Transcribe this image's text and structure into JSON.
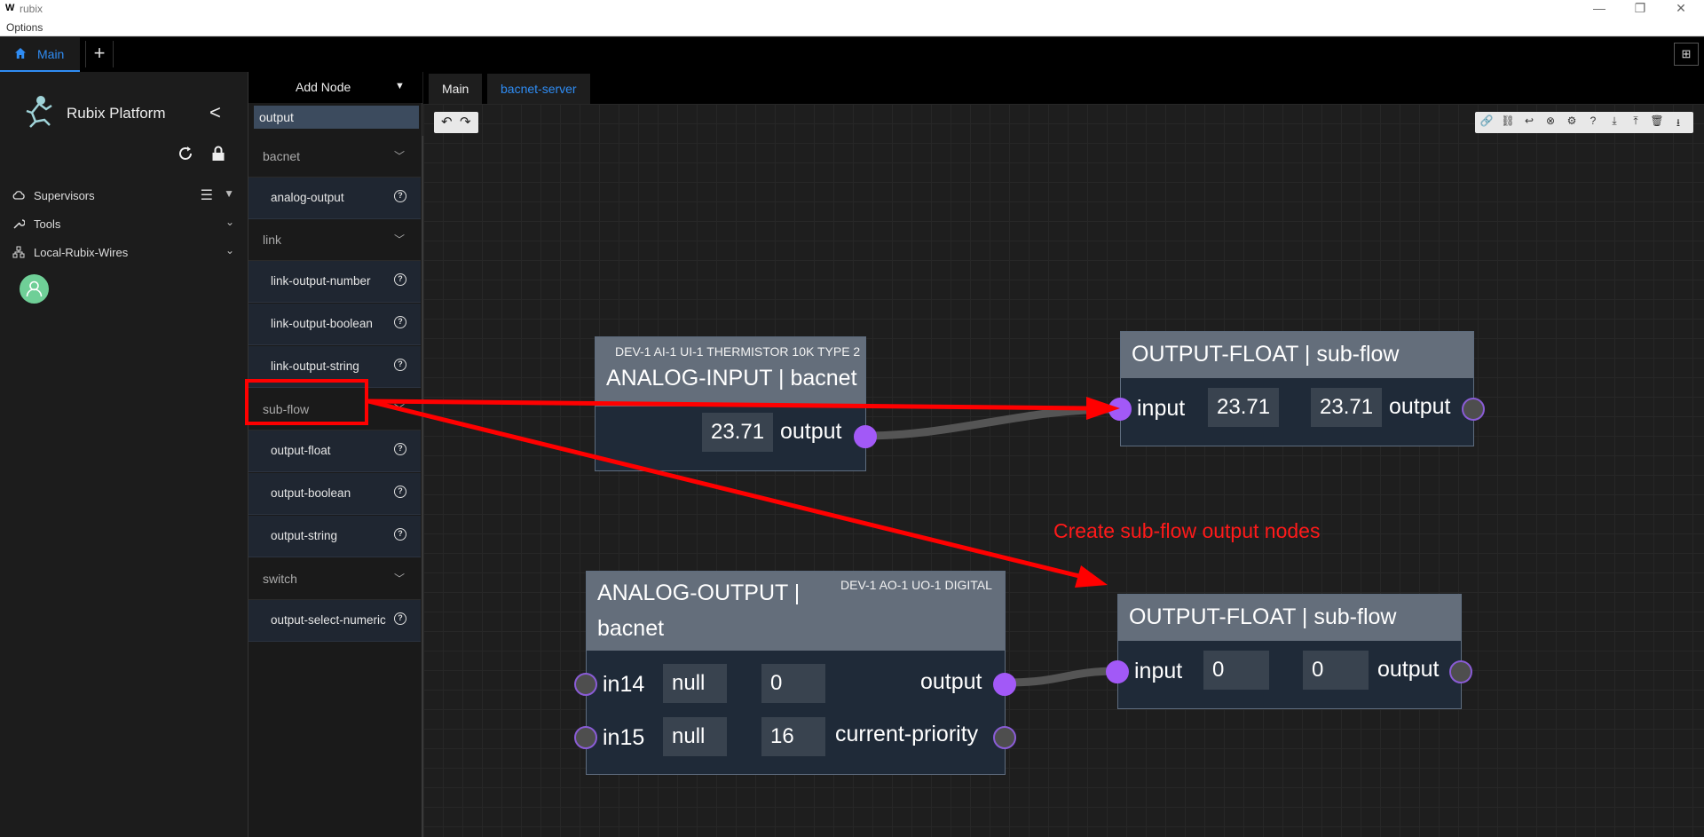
{
  "window": {
    "logo": "W",
    "title": "rubix",
    "minimize": "—",
    "restore": "❐",
    "close": "✕"
  },
  "menu": {
    "options": "Options"
  },
  "tabs": {
    "main": "Main",
    "add": "+",
    "layout_icon": "layout-icon"
  },
  "sidebar": {
    "title": "Rubix Platform",
    "collapse": "<",
    "items": [
      {
        "label": "Supervisors",
        "icon": "cloud-icon"
      },
      {
        "label": "Tools",
        "icon": "wrench-icon"
      },
      {
        "label": "Local-Rubix-Wires",
        "icon": "network-icon"
      }
    ]
  },
  "node_panel": {
    "header": "Add Node",
    "search_value": "output",
    "categories": [
      {
        "label": "bacnet",
        "nodes": [
          "analog-output"
        ]
      },
      {
        "label": "link",
        "nodes": [
          "link-output-number",
          "link-output-boolean",
          "link-output-string"
        ]
      },
      {
        "label": "sub-flow",
        "nodes": [
          "output-float",
          "output-boolean",
          "output-string"
        ]
      },
      {
        "label": "switch",
        "nodes": [
          "output-select-numeric"
        ]
      }
    ]
  },
  "canvas_tabs": [
    "Main",
    "bacnet-server"
  ],
  "canvas": {
    "undo": "↶",
    "redo": "↷",
    "toolbar_icons": [
      "link-icon",
      "unlink-icon",
      "return-icon",
      "close-circle-icon",
      "settings-icon",
      "help-icon",
      "download-icon",
      "upload-icon",
      "delete-icon",
      "export-icon"
    ]
  },
  "nodes": {
    "analog_input": {
      "subtitle": "DEV-1 AI-1 UI-1 THERMISTOR 10K TYPE 2",
      "title": "ANALOG-INPUT | bacnet",
      "value": "23.71",
      "output_label": "output"
    },
    "output_float_1": {
      "title": "OUTPUT-FLOAT | sub-flow",
      "input_label": "input",
      "input_value": "23.71",
      "output_value": "23.71",
      "output_label": "output"
    },
    "analog_output": {
      "title_line1": "ANALOG-OUTPUT |",
      "title_line2": "bacnet",
      "subtitle": "DEV-1 AO-1 UO-1 DIGITAL",
      "rows": [
        {
          "input": "in14",
          "value1": "null",
          "value2": "0",
          "output": "output"
        },
        {
          "input": "in15",
          "value1": "null",
          "value2": "16",
          "output": "current-priority"
        }
      ]
    },
    "output_float_2": {
      "title": "OUTPUT-FLOAT | sub-flow",
      "input_label": "input",
      "input_value": "0",
      "output_value": "0",
      "output_label": "output"
    }
  },
  "annotation": "Create sub-flow output nodes",
  "colors": {
    "accent_blue": "#2f8cf3",
    "port_purple": "#a259f7",
    "annotation_red": "#ff1a1a",
    "node_header": "#646e7b",
    "node_body": "#1f2a38"
  }
}
